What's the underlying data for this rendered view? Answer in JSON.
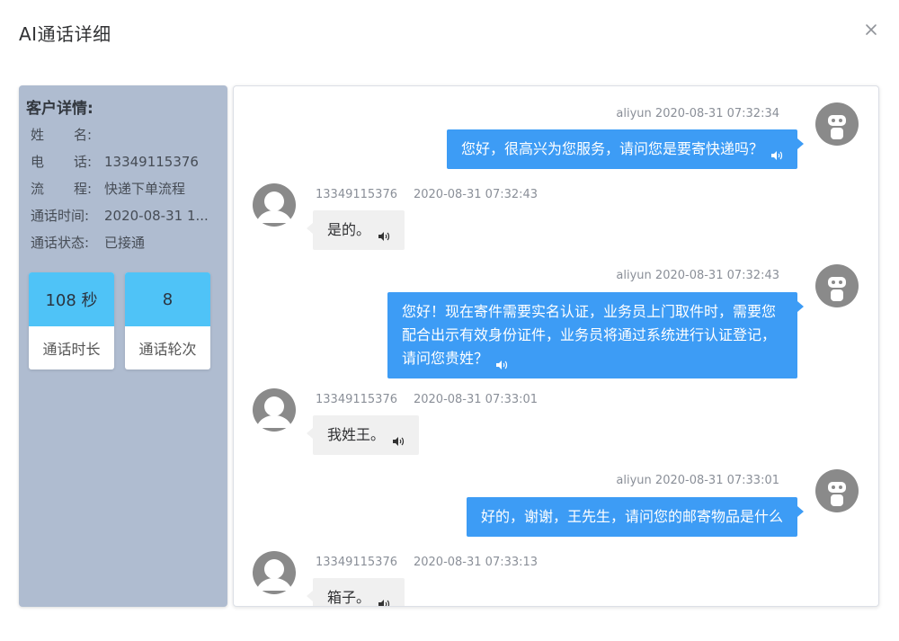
{
  "dialog": {
    "title": "AI通话详细"
  },
  "customer": {
    "heading": "客户详情:",
    "rows": [
      {
        "label_a": "姓",
        "label_b": "名:",
        "value": ""
      },
      {
        "label_a": "电",
        "label_b": "话:",
        "value": "13349115376"
      },
      {
        "label_a": "流",
        "label_b": "程:",
        "value": "快递下单流程"
      },
      {
        "label": "通话时间:",
        "value": "2020-08-31 1..."
      },
      {
        "label": "通话状态:",
        "value": "已接通"
      }
    ]
  },
  "stats": [
    {
      "value": "108 秒",
      "label": "通话时长"
    },
    {
      "value": "8",
      "label": "通话轮次"
    }
  ],
  "messages": [
    {
      "role": "agent",
      "user": "aliyun",
      "time": "2020-08-31 07:32:34",
      "text": "您好，很高兴为您服务，请问您是要寄快递吗？"
    },
    {
      "role": "user",
      "user": "13349115376",
      "time": "2020-08-31 07:32:43",
      "text": "是的。"
    },
    {
      "role": "agent",
      "user": "aliyun",
      "time": "2020-08-31 07:32:43",
      "text": "您好！现在寄件需要实名认证，业务员上门取件时，需要您配合出示有效身份证件，业务员将通过系统进行认证登记，请问您贵姓？"
    },
    {
      "role": "user",
      "user": "13349115376",
      "time": "2020-08-31 07:33:01",
      "text": "我姓王。"
    },
    {
      "role": "agent",
      "user": "aliyun",
      "time": "2020-08-31 07:33:01",
      "text": "好的，谢谢，王先生，请问您的邮寄物品是什么"
    },
    {
      "role": "user",
      "user": "13349115376",
      "time": "2020-08-31 07:33:13",
      "text": "箱子。"
    }
  ],
  "colors": {
    "agent_bubble": "#3d9cf5",
    "user_bubble": "#f0f0f0",
    "stat_header": "#4fc3f7",
    "left_panel": "#afbcd0"
  },
  "icons": {
    "close": "close-icon",
    "speaker": "speaker-icon",
    "robot": "robot-avatar-icon",
    "person": "person-avatar-icon"
  }
}
